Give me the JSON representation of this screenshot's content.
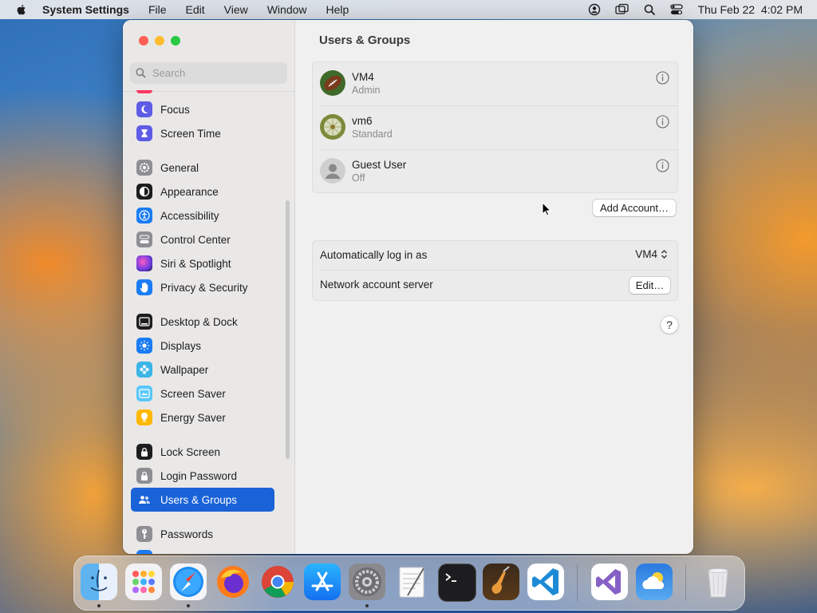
{
  "menubar": {
    "app_name": "System Settings",
    "items": [
      "File",
      "Edit",
      "View",
      "Window",
      "Help"
    ],
    "clock": "Thu Feb 22  4:02 PM"
  },
  "sidebar": {
    "search_placeholder": "Search",
    "items": [
      {
        "label": "Focus",
        "icon": "moon-icon",
        "color": "#5e5ce6"
      },
      {
        "label": "Screen Time",
        "icon": "hourglass-icon",
        "color": "#5e5ce6"
      },
      {
        "label": "General",
        "icon": "gear-icon",
        "color": "#8e8e93"
      },
      {
        "label": "Appearance",
        "icon": "appearance-icon",
        "color": "#1d1d1f"
      },
      {
        "label": "Accessibility",
        "icon": "accessibility-icon",
        "color": "#1a7cf5"
      },
      {
        "label": "Control Center",
        "icon": "control-center-icon",
        "color": "#8e8e93"
      },
      {
        "label": "Siri & Spotlight",
        "icon": "siri-icon",
        "color": "#b04bd6"
      },
      {
        "label": "Privacy & Security",
        "icon": "hand-icon",
        "color": "#1a7cf5"
      },
      {
        "label": "Desktop & Dock",
        "icon": "dock-icon",
        "color": "#1d1d1f"
      },
      {
        "label": "Displays",
        "icon": "sun-icon",
        "color": "#1a7cf5"
      },
      {
        "label": "Wallpaper",
        "icon": "wallpaper-icon",
        "color": "#3ab5e6"
      },
      {
        "label": "Screen Saver",
        "icon": "screen-saver-icon",
        "color": "#5ac8fa"
      },
      {
        "label": "Energy Saver",
        "icon": "lightbulb-icon",
        "color": "#ffb800"
      },
      {
        "label": "Lock Screen",
        "icon": "lock-icon",
        "color": "#1d1d1f"
      },
      {
        "label": "Login Password",
        "icon": "lock-icon",
        "color": "#8e8e93"
      },
      {
        "label": "Users & Groups",
        "icon": "users-icon",
        "color": "#1a62d8"
      },
      {
        "label": "Passwords",
        "icon": "key-icon",
        "color": "#8e8e93"
      }
    ],
    "selected": "Users & Groups"
  },
  "content": {
    "title": "Users & Groups",
    "users": [
      {
        "name": "VM4",
        "role": "Admin",
        "avatar": "football-avatar"
      },
      {
        "name": "vm6",
        "role": "Standard",
        "avatar": "dandelion-avatar"
      },
      {
        "name": "Guest User",
        "role": "Off",
        "avatar": "person-avatar"
      }
    ],
    "add_account_label": "Add Account…",
    "auto_login_label": "Automatically log in as",
    "auto_login_value": "VM4",
    "network_server_label": "Network account server",
    "edit_label": "Edit…",
    "help_label": "?"
  },
  "dock": {
    "apps": [
      "Finder",
      "Launchpad",
      "Safari",
      "Firefox",
      "Chrome",
      "App Store",
      "System Settings",
      "TextEdit",
      "Terminal",
      "GarageBand",
      "Visual Studio Code",
      "Visual Studio",
      "Weather",
      "Trash"
    ]
  }
}
